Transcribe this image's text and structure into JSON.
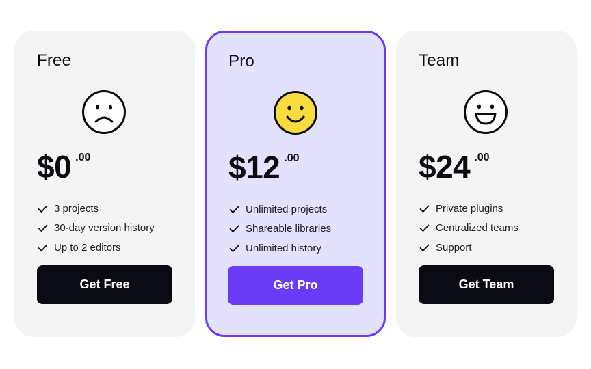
{
  "plans": [
    {
      "name": "Free",
      "face_icon": "sad-face-icon",
      "price_dollars": "$0",
      "price_cents": ".00",
      "features": [
        "3 projects",
        "30-day version history",
        "Up to 2 editors"
      ],
      "cta_label": "Get Free"
    },
    {
      "name": "Pro",
      "face_icon": "smile-face-icon",
      "price_dollars": "$12",
      "price_cents": ".00",
      "features": [
        "Unlimited projects",
        "Shareable libraries",
        "Unlimited history"
      ],
      "cta_label": "Get Pro",
      "highlighted": true
    },
    {
      "name": "Team",
      "face_icon": "grin-face-icon",
      "price_dollars": "$24",
      "price_cents": ".00",
      "features": [
        "Private plugins",
        "Centralized teams",
        "Support"
      ],
      "cta_label": "Get Team"
    }
  ],
  "colors": {
    "card_background": "#f4f4f4",
    "highlight_background": "#e3e2fc",
    "highlight_border": "#6a3cf0",
    "primary_button": "#0a0a12",
    "accent_button": "#6a3cf7",
    "face_fill_pro": "#f8dc40"
  }
}
